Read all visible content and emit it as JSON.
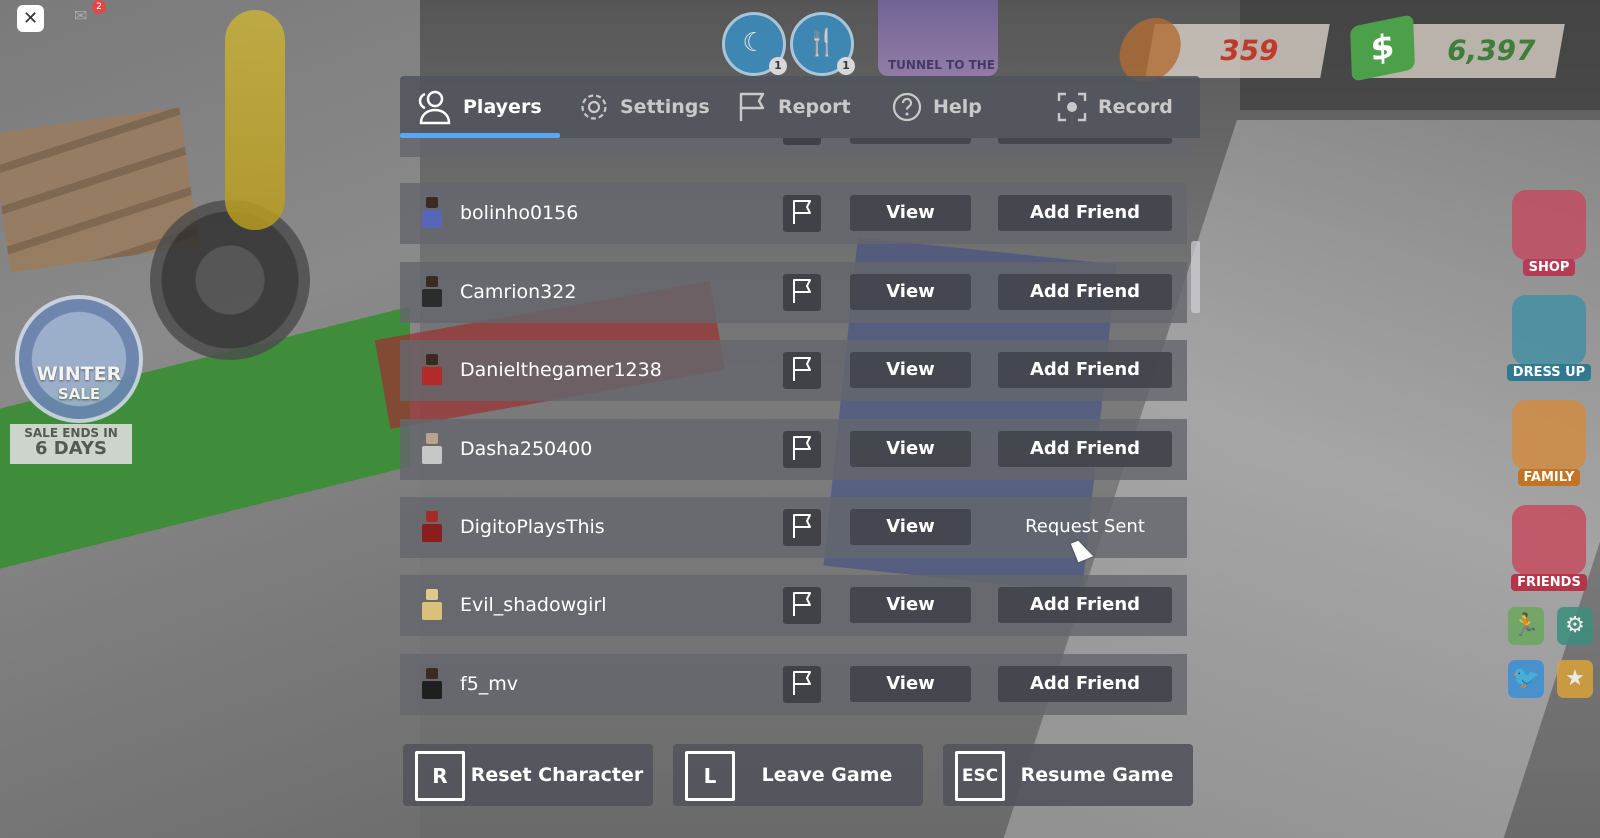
{
  "hud": {
    "close_glyph": "✕",
    "notification_count": "2",
    "sleep_badge": "1",
    "food_badge": "1",
    "banner_text": "TUNNEL TO THE",
    "cookie_count": "359",
    "money_symbol": "$",
    "money_count": "6,397"
  },
  "promo": {
    "winter_line1": "WINTER",
    "winter_line2": "SALE",
    "sale_ends_line1": "SALE ENDS IN",
    "sale_ends_line2": "6 DAYS"
  },
  "side_menu": {
    "shop": "SHOP",
    "dress_up": "DRESS UP",
    "family": "FAMILY",
    "friends": "FRIENDS"
  },
  "tabs": [
    {
      "label": "Players",
      "icon": "players-icon",
      "active": true
    },
    {
      "label": "Settings",
      "icon": "gear-icon",
      "active": false
    },
    {
      "label": "Report",
      "icon": "flag-icon",
      "active": false
    },
    {
      "label": "Help",
      "icon": "help-icon",
      "active": false
    },
    {
      "label": "Record",
      "icon": "record-icon",
      "active": false
    }
  ],
  "players": [
    {
      "name": "bolinho0156",
      "view_label": "View",
      "friend_label": "Add Friend",
      "friend_status": "add",
      "avatar_color": "#5866b8"
    },
    {
      "name": "Camrion322",
      "view_label": "View",
      "friend_label": "Add Friend",
      "friend_status": "add",
      "avatar_color": "#2c2c2c"
    },
    {
      "name": "Danielthegamer1238",
      "view_label": "View",
      "friend_label": "Add Friend",
      "friend_status": "add",
      "avatar_color": "#b22a2a"
    },
    {
      "name": "Dasha250400",
      "view_label": "View",
      "friend_label": "Add Friend",
      "friend_status": "add",
      "avatar_color": "#c7c7c7"
    },
    {
      "name": "DigitoPlaysThis",
      "view_label": "View",
      "friend_label": "Request Sent",
      "friend_status": "sent",
      "avatar_color": "#8a1d1d"
    },
    {
      "name": "Evil_shadowgirl",
      "view_label": "View",
      "friend_label": "Add Friend",
      "friend_status": "add",
      "avatar_color": "#d8c27a"
    },
    {
      "name": "f5_mv",
      "view_label": "View",
      "friend_label": "Add Friend",
      "friend_status": "add",
      "avatar_color": "#1f1f1f"
    }
  ],
  "bottom_actions": [
    {
      "key": "R",
      "label": "Reset Character"
    },
    {
      "key": "L",
      "label": "Leave Game"
    },
    {
      "key": "ESC",
      "label": "Resume Game"
    }
  ],
  "colors": {
    "tab_accent": "#58a7f7",
    "panel": "#52545c",
    "cookie_text": "#c0392b",
    "money_text": "#3f7d3a"
  }
}
